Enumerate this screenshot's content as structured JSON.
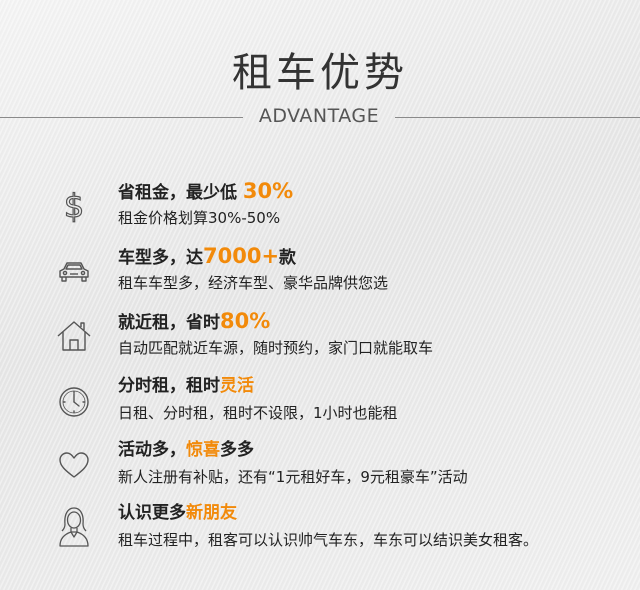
{
  "header": {
    "title": "租车优势",
    "subtitle": "ADVANTAGE"
  },
  "colors": {
    "accent": "#f28a0a",
    "text": "#222222",
    "icon": "#555555"
  },
  "items": [
    {
      "icon": "dollar-icon",
      "head_pre": "省租金，最少低 ",
      "head_hl": "30%",
      "head_post": "",
      "desc": "租金价格划算30%-50%"
    },
    {
      "icon": "car-icon",
      "head_pre": "车型多，达",
      "head_hl": "7000+",
      "head_post": "款",
      "desc": "租车车型多，经济车型、豪华品牌供您选"
    },
    {
      "icon": "house-icon",
      "head_pre": "就近租，省时",
      "head_hl": "80%",
      "head_post": "",
      "desc": "自动匹配就近车源，随时预约，家门口就能取车"
    },
    {
      "icon": "clock-icon",
      "head_pre": "分时租，租时",
      "head_hl": "灵活",
      "head_post": "",
      "desc": "日租、分时租，租时不设限，1小时也能租"
    },
    {
      "icon": "heart-icon",
      "head_pre": "活动多，",
      "head_hl": "惊喜",
      "head_post": "多多",
      "desc": "新人注册有补贴，还有“1元租好车，9元租豪车”活动"
    },
    {
      "icon": "person-icon",
      "head_pre": "认识更多",
      "head_hl": "新朋友",
      "head_post": "",
      "desc": "租车过程中，租客可以认识帅气车东，车东可以结识美女租客。"
    }
  ]
}
